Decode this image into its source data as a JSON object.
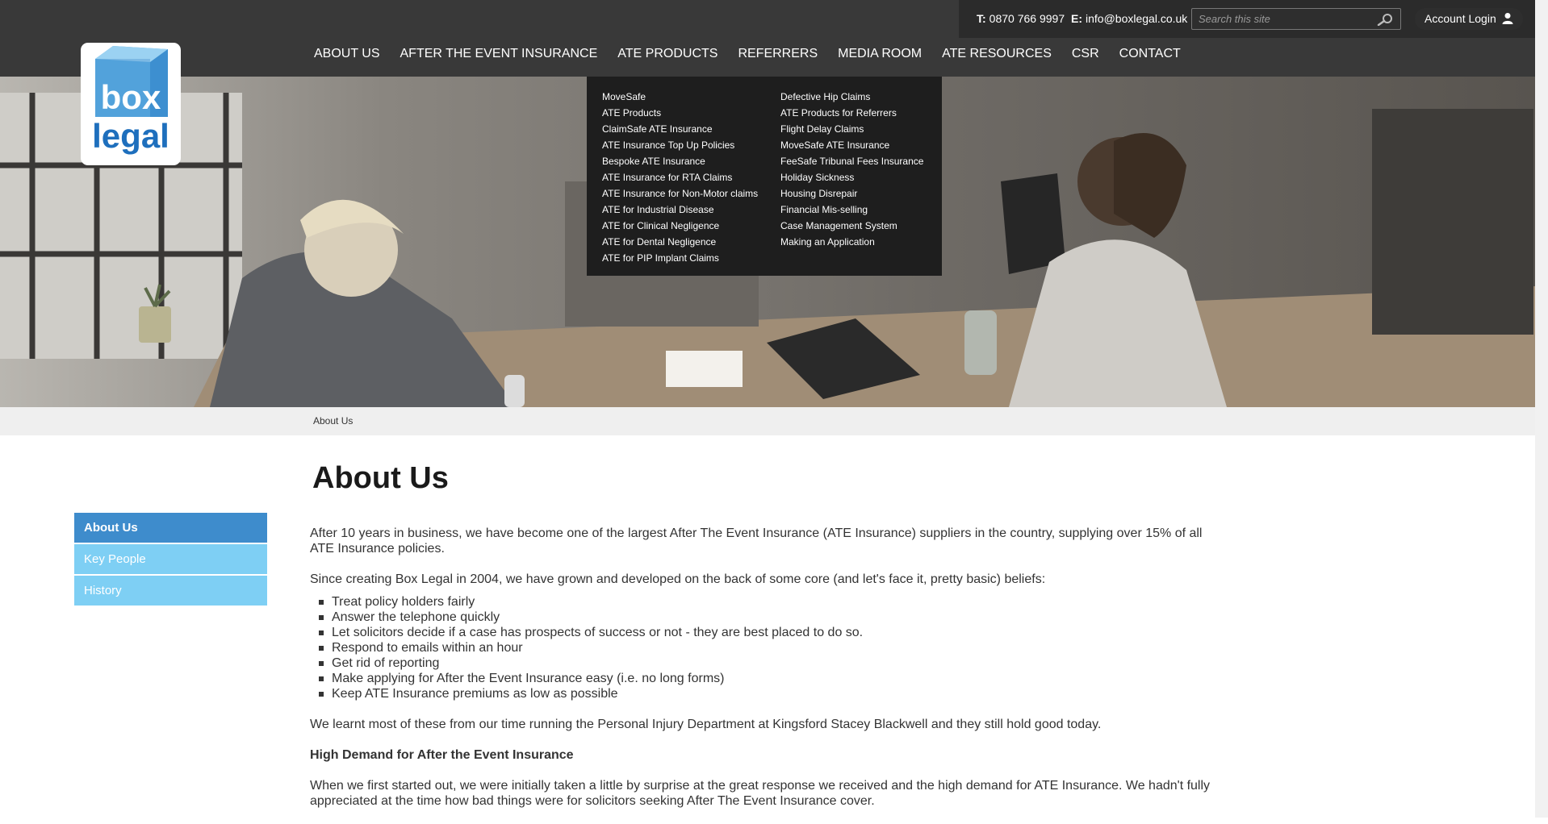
{
  "topbar": {
    "phone_label": "T:",
    "phone": "0870 766 9997",
    "email_label": "E:",
    "email": "info@boxlegal.co.uk",
    "search_placeholder": "Search this site",
    "account_label": "Account Login"
  },
  "logo": {
    "line1": "box",
    "line2": "legal"
  },
  "nav": [
    "ABOUT US",
    "AFTER THE EVENT INSURANCE",
    "ATE PRODUCTS",
    "REFERRERS",
    "MEDIA ROOM",
    "ATE RESOURCES",
    "CSR",
    "CONTACT"
  ],
  "dropdown": {
    "col1": [
      "MoveSafe",
      "ATE Products",
      "ClaimSafe ATE Insurance",
      "ATE Insurance Top Up Policies",
      "Bespoke ATE Insurance",
      "ATE Insurance for RTA Claims",
      "ATE Insurance for Non-Motor claims",
      "ATE for Industrial Disease",
      "ATE for Clinical Negligence",
      "ATE for Dental Negligence",
      "ATE for PIP Implant Claims"
    ],
    "col2": [
      "Defective Hip Claims",
      "ATE Products for Referrers",
      "Flight Delay Claims",
      "MoveSafe ATE Insurance",
      "FeeSafe Tribunal Fees Insurance",
      "Holiday Sickness",
      "Housing Disrepair",
      "Financial Mis-selling",
      "Case Management System",
      "Making an Application"
    ]
  },
  "breadcrumb": "About Us",
  "page_title": "About Us",
  "sidebar": [
    "About Us",
    "Key People",
    "History"
  ],
  "content": {
    "p1": "After 10 years in business, we have become one of the largest After The Event Insurance (ATE Insurance) suppliers in the country, supplying over 15% of all ATE Insurance policies.",
    "p2": "Since creating Box Legal in 2004, we have grown and developed on the back of some core (and let's face it, pretty basic) beliefs:",
    "beliefs": [
      "Treat policy holders fairly",
      "Answer the telephone quickly",
      "Let solicitors decide if a case has prospects of success or not - they are best placed to do so.",
      "Respond to emails within an hour",
      "Get rid of reporting",
      "Make applying for After the Event Insurance easy (i.e. no long forms)",
      "Keep ATE Insurance premiums as low as possible"
    ],
    "p3": "We learnt most of these from our time running the Personal Injury Department at Kingsford Stacey Blackwell and they still hold good today.",
    "h2": "High Demand for After the Event Insurance",
    "p4": "When we first started out, we were initially taken a little by surprise at the great response we received and the high demand for ATE Insurance. We hadn't fully appreciated at the time how bad things were for solicitors seeking After The Event Insurance cover."
  },
  "colors": {
    "header_bg": "#393939",
    "topbar_bg": "#2b2b2b",
    "dropdown_bg": "#1e1e1e",
    "sidebar_active": "#3e8ccc",
    "sidebar_item": "#7ecff4",
    "logo_blue": "#1e6fbd"
  }
}
